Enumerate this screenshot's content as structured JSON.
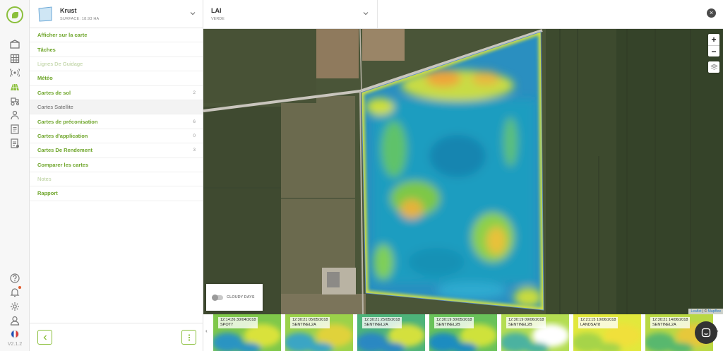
{
  "app": {
    "version": "V2.1.2"
  },
  "farm": {
    "name": "Krust",
    "surface": "SURFACE: 18.93 HA"
  },
  "layer": {
    "title": "LAI",
    "subtitle": "VERDE"
  },
  "menu": {
    "items": [
      {
        "label": "Afficher sur la carte",
        "count": "",
        "state": "normal"
      },
      {
        "label": "Tâches",
        "count": "",
        "state": "normal"
      },
      {
        "label": "Lignes De Guidage",
        "count": "",
        "state": "dim"
      },
      {
        "label": "Météo",
        "count": "",
        "state": "normal"
      },
      {
        "label": "Cartes de sol",
        "count": "2",
        "state": "normal"
      },
      {
        "label": "Cartes Satellite",
        "count": "",
        "state": "active"
      },
      {
        "label": "Cartes de préconisation",
        "count": "6",
        "state": "normal"
      },
      {
        "label": "Cartes d'application",
        "count": "0",
        "state": "normal"
      },
      {
        "label": "Cartes De Rendement",
        "count": "3",
        "state": "normal"
      },
      {
        "label": "Comparer les cartes",
        "count": "",
        "state": "normal"
      },
      {
        "label": "Notes",
        "count": "",
        "state": "dim"
      },
      {
        "label": "Rapport",
        "count": "",
        "state": "normal"
      }
    ]
  },
  "map": {
    "zoom_in": "+",
    "zoom_out": "−",
    "cloudy_label": "CLOUDY DAYS",
    "attribution_leaflet": "Leaflet",
    "attribution_sep": " | © ",
    "attribution_mapbox": "MapBox"
  },
  "timeline": {
    "thumbs": [
      {
        "time": "12:14:26 30/04/2018",
        "sat": "SPOT7"
      },
      {
        "time": "12:30:21 05/05/2018",
        "sat": "SENTINEL2A"
      },
      {
        "time": "12:30:21 25/05/2018",
        "sat": "SENTINEL2A"
      },
      {
        "time": "12:30:19 30/05/2018",
        "sat": "SENTINEL2B"
      },
      {
        "time": "12:30:19 09/06/2018",
        "sat": "SENTINEL2B"
      },
      {
        "time": "12:21:15 10/06/2018",
        "sat": "LANDSAT8"
      },
      {
        "time": "12:30:21 14/06/2018",
        "sat": "SENTINEL2A"
      }
    ]
  },
  "colors": {
    "accent": "#8bbf3c",
    "link": "#6ea52a"
  },
  "icons": {
    "rail": [
      "farm-icon",
      "grid-icon",
      "signal-icon",
      "field-icon",
      "tractor-icon",
      "people-icon",
      "document-icon",
      "report-icon",
      "help-icon",
      "bell-icon",
      "settings-icon",
      "user-icon",
      "flag-fr-icon"
    ]
  }
}
